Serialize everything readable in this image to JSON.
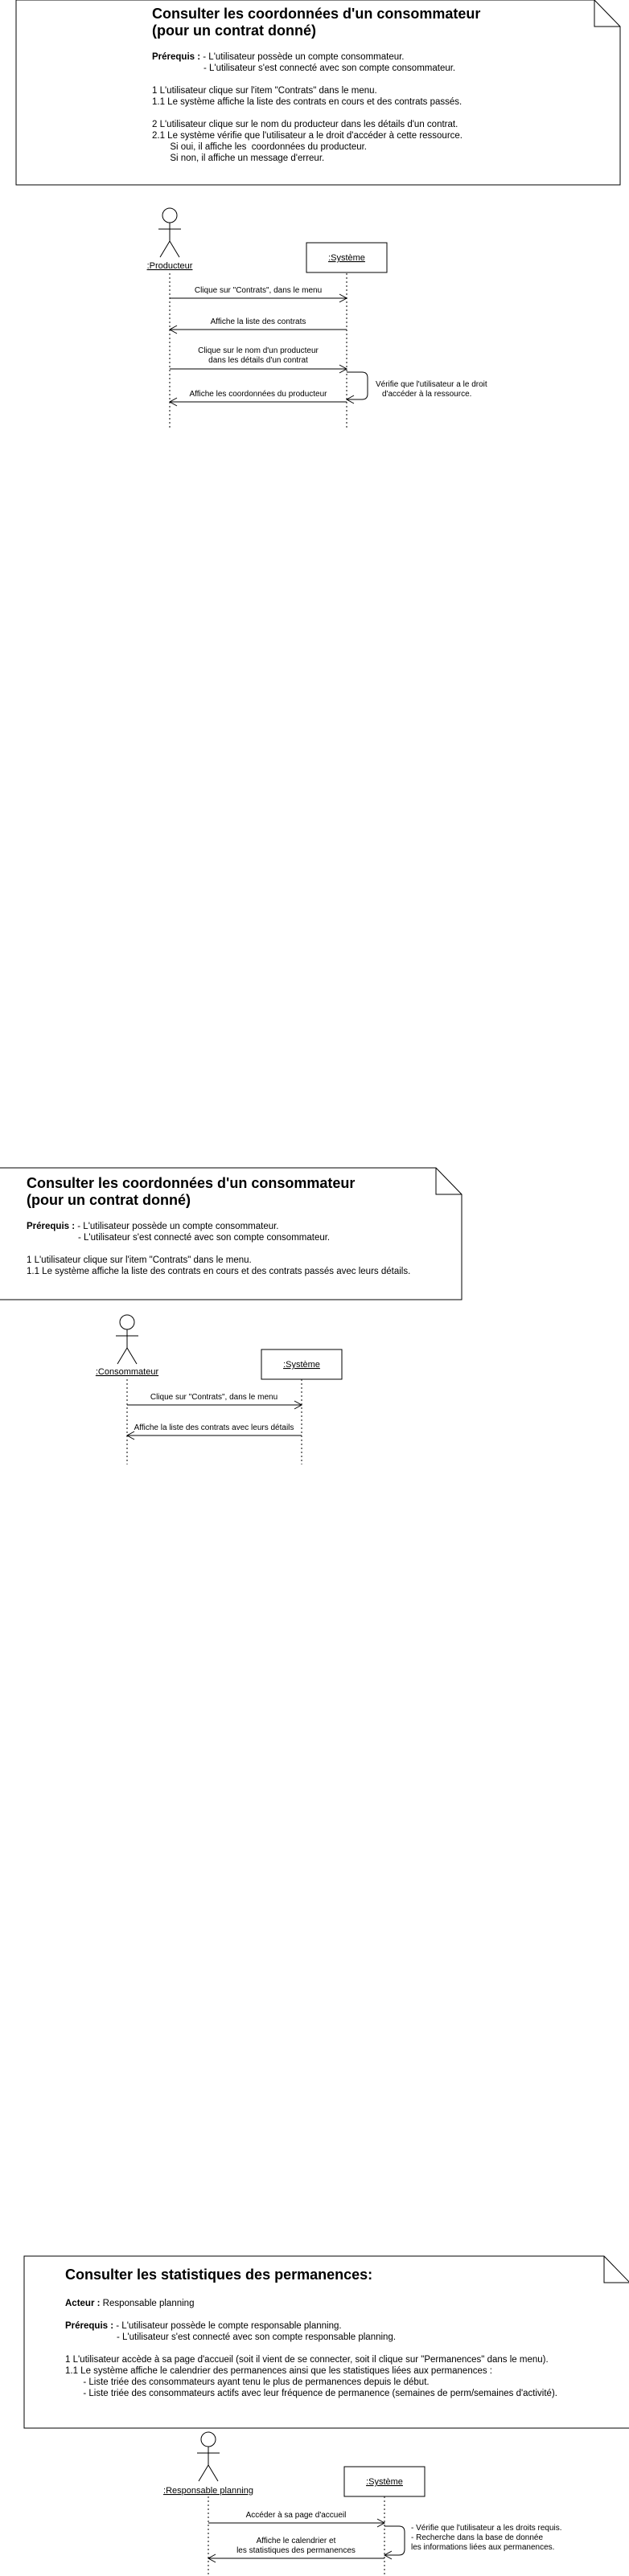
{
  "diagrams": [
    {
      "title_lines": [
        "Consulter les coordonnées d'un consommateur",
        "(pour un contrat donné)"
      ],
      "prereq_label": "Prérequis :",
      "prereq_items": [
        "- L'utilisateur possède un compte consommateur.",
        "- L'utilisateur s'est connecté avec son compte consommateur."
      ],
      "steps": [
        "1 L'utilisateur clique sur l'item \"Contrats\" dans le menu.",
        "1.1 Le système affiche la liste des contrats en cours et des contrats passés.",
        "",
        "2 L'utilisateur clique sur le nom du producteur dans les détails d'un contrat.",
        "2.1 Le système vérifie que l'utilisateur a le droit d'accéder à cette ressource.",
        "       Si oui, il affiche les  coordonnées du producteur.",
        "       Si non, il affiche un message d'erreur."
      ],
      "actor": ":Producteur",
      "system": ":Système",
      "messages": [
        {
          "lines": [
            "Clique sur \"Contrats\", dans le menu"
          ],
          "dir": "right"
        },
        {
          "lines": [
            "Affiche la liste des contrats"
          ],
          "dir": "left"
        },
        {
          "lines": [
            "Clique sur le nom d'un producteur",
            "dans les détails d'un contrat"
          ],
          "dir": "right"
        },
        {
          "lines": [
            "Affiche les coordonnées du producteur"
          ],
          "dir": "left"
        }
      ],
      "self_note": [
        "Vérifie que l'utilisateur a le droit",
        "d'accéder à la ressource."
      ]
    },
    {
      "title_lines": [
        "Consulter les coordonnées d'un consommateur",
        "(pour un contrat donné)"
      ],
      "prereq_label": "Prérequis :",
      "prereq_items": [
        "- L'utilisateur possède un compte consommateur.",
        "- L'utilisateur s'est connecté avec son compte consommateur."
      ],
      "steps": [
        "1 L'utilisateur clique sur l'item \"Contrats\" dans le menu.",
        "1.1 Le système affiche la liste des contrats en cours et des contrats passés avec leurs détails."
      ],
      "actor": ":Consommateur",
      "system": ":Système",
      "messages": [
        {
          "lines": [
            "Clique sur \"Contrats\", dans le menu"
          ],
          "dir": "right"
        },
        {
          "lines": [
            "Affiche la liste des contrats avec leurs détails"
          ],
          "dir": "left"
        }
      ]
    },
    {
      "title_lines": [
        "Consulter les statistiques des permanences:"
      ],
      "acteur_label": "Acteur :",
      "acteur_value": "Responsable planning",
      "prereq_label": "Prérequis :",
      "prereq_items": [
        "- L'utilisateur possède le compte responsable planning.",
        "- L'utilisateur s'est connecté avec son compte responsable planning."
      ],
      "steps": [
        "1 L'utilisateur accède à sa page d'accueil (soit il vient de se connecter, soit il clique sur \"Permanences\" dans le menu).",
        "1.1 Le système affiche le calendrier des permanences ainsi que les statistiques liées aux permanences :",
        "       - Liste triée des consommateurs ayant tenu le plus de permanences depuis le début.",
        "       - Liste triée des consommateurs actifs avec leur fréquence de permanence (semaines de perm/semaines d'activité)."
      ],
      "actor": ":Responsable planning",
      "system": ":Système",
      "messages": [
        {
          "lines": [
            "Accéder à sa page d'accueil"
          ],
          "dir": "right"
        },
        {
          "lines": [
            "Affiche le calendrier et",
            "les statistiques des permanences"
          ],
          "dir": "left"
        }
      ],
      "self_note": [
        "- Vérifie que l'utilisateur a les droits requis.",
        "- Recherche dans la base de donnée",
        "les informations liées aux permanences."
      ]
    }
  ]
}
